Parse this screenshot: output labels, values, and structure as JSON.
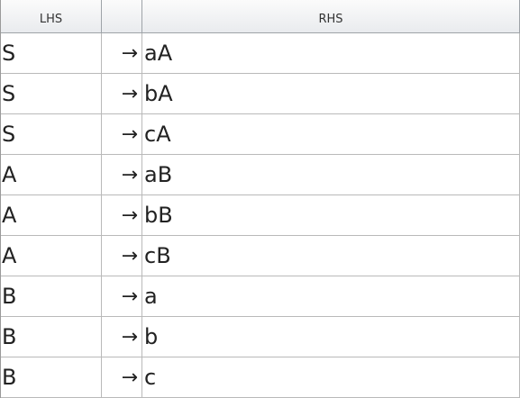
{
  "table": {
    "headers": {
      "lhs": "LHS",
      "arrow": "",
      "rhs": "RHS"
    },
    "rows": [
      {
        "lhs": "S",
        "arrow": "→",
        "rhs": "aA"
      },
      {
        "lhs": "S",
        "arrow": "→",
        "rhs": "bA"
      },
      {
        "lhs": "S",
        "arrow": "→",
        "rhs": "cA"
      },
      {
        "lhs": "A",
        "arrow": "→",
        "rhs": "aB"
      },
      {
        "lhs": "A",
        "arrow": "→",
        "rhs": "bB"
      },
      {
        "lhs": "A",
        "arrow": "→",
        "rhs": "cB"
      },
      {
        "lhs": "B",
        "arrow": "→",
        "rhs": "a"
      },
      {
        "lhs": "B",
        "arrow": "→",
        "rhs": "b"
      },
      {
        "lhs": "B",
        "arrow": "→",
        "rhs": "c"
      }
    ]
  }
}
